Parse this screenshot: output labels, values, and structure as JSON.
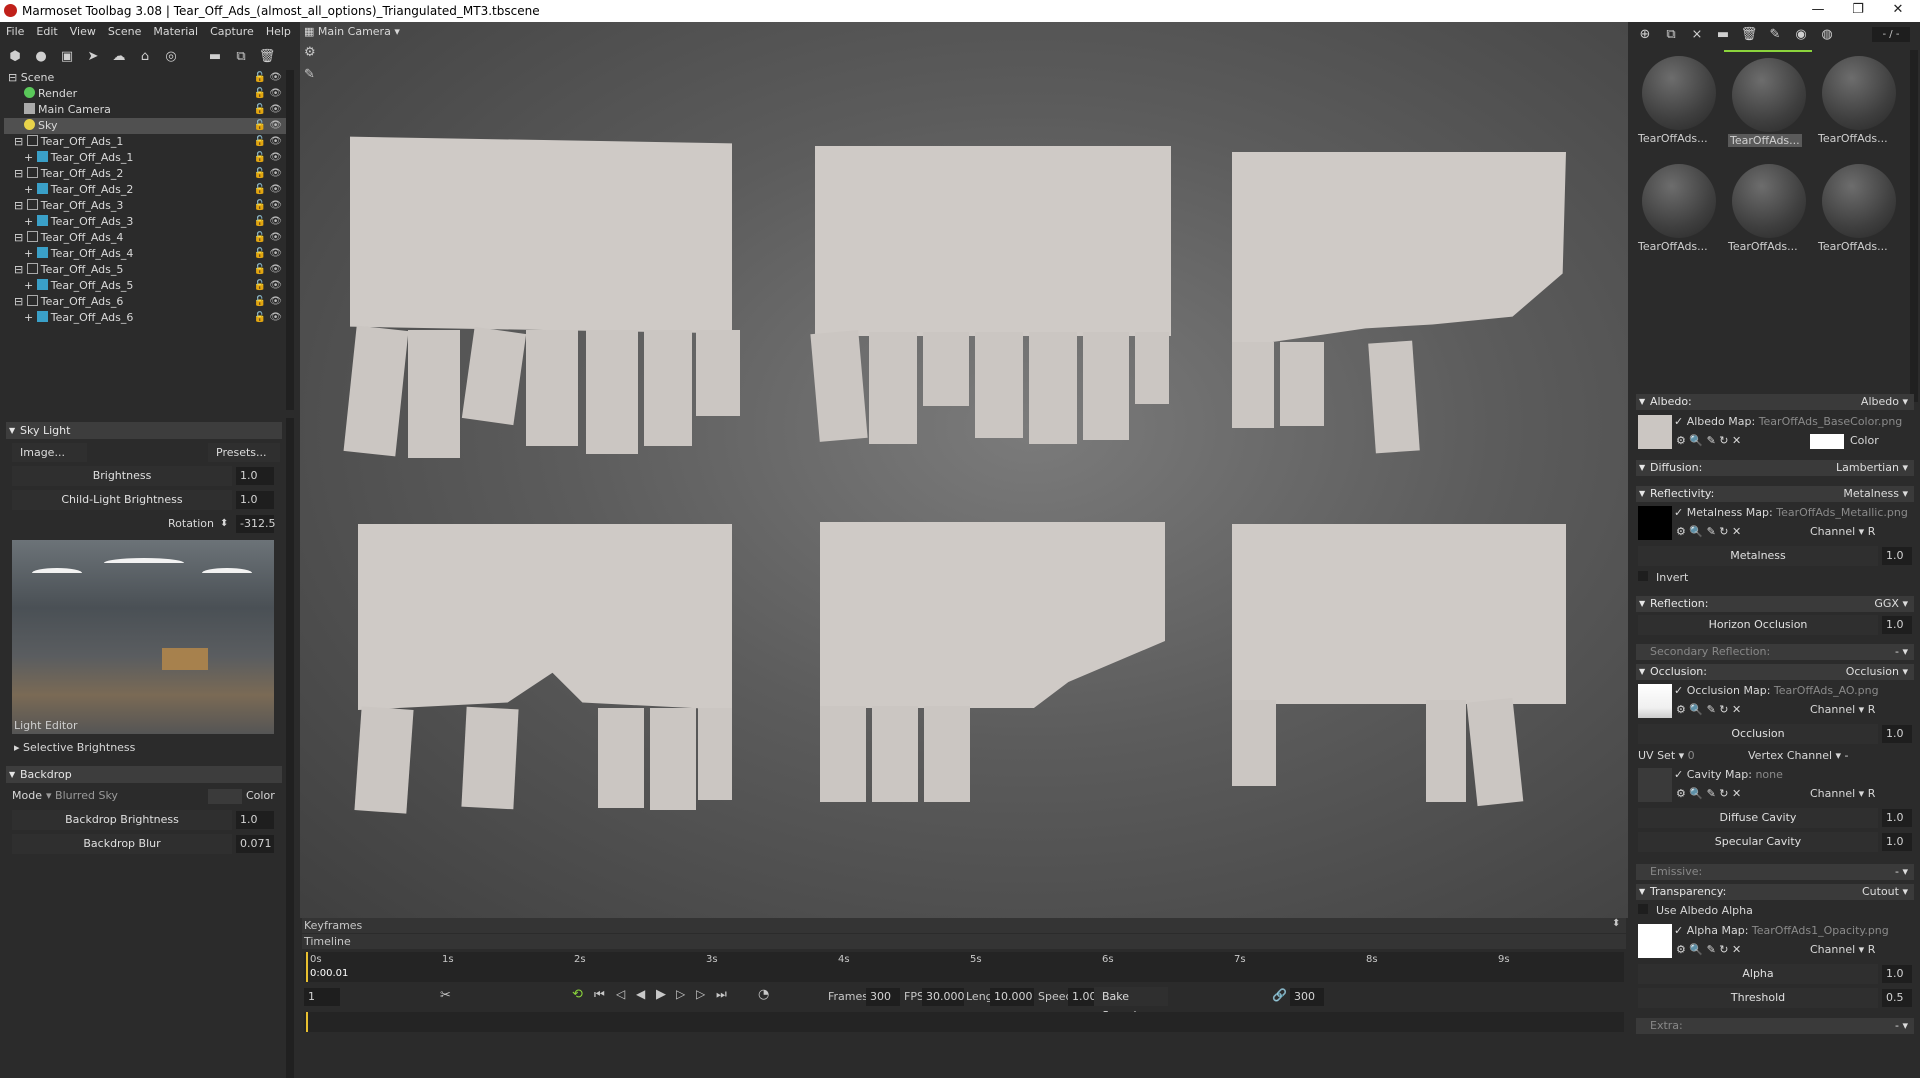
{
  "window": {
    "title": "Marmoset Toolbag 3.08  |  Tear_Off_Ads_(almost_all_options)_Triangulated_MT3.tbscene",
    "min": "—",
    "max": "❐",
    "close": "✕"
  },
  "menu": [
    "File",
    "Edit",
    "View",
    "Scene",
    "Material",
    "Capture",
    "Help"
  ],
  "viewport_header": {
    "camera": "Main Camera"
  },
  "scene_tree": [
    {
      "label": "Scene",
      "indent": 0
    },
    {
      "label": "Render",
      "indent": 1
    },
    {
      "label": "Main Camera",
      "indent": 1
    },
    {
      "label": "Sky",
      "indent": 1,
      "selected": true
    },
    {
      "label": "Tear_Off_Ads_1",
      "indent": 1
    },
    {
      "label": "Tear_Off_Ads_1",
      "indent": 2
    },
    {
      "label": "Tear_Off_Ads_2",
      "indent": 1
    },
    {
      "label": "Tear_Off_Ads_2",
      "indent": 2
    },
    {
      "label": "Tear_Off_Ads_3",
      "indent": 1
    },
    {
      "label": "Tear_Off_Ads_3",
      "indent": 2
    },
    {
      "label": "Tear_Off_Ads_4",
      "indent": 1
    },
    {
      "label": "Tear_Off_Ads_4",
      "indent": 2
    },
    {
      "label": "Tear_Off_Ads_5",
      "indent": 1
    },
    {
      "label": "Tear_Off_Ads_5",
      "indent": 2
    },
    {
      "label": "Tear_Off_Ads_6",
      "indent": 1
    },
    {
      "label": "Tear_Off_Ads_6",
      "indent": 2
    }
  ],
  "sky_light": {
    "header": "Sky Light",
    "image_btn": "Image...",
    "presets_btn": "Presets...",
    "brightness_label": "Brightness",
    "brightness": "1.0",
    "child_label": "Child-Light Brightness",
    "child": "1.0",
    "rotation_label": "Rotation",
    "rotation": "-312.5",
    "light_editor": "Light Editor",
    "selective": "Selective Brightness"
  },
  "backdrop": {
    "header": "Backdrop",
    "mode_label": "Mode",
    "mode_value": "Blurred Sky",
    "color_label": "Color",
    "brightness_label": "Backdrop Brightness",
    "brightness": "1.0",
    "blur_label": "Backdrop Blur",
    "blur": "0.071"
  },
  "timeline": {
    "keyframes": "Keyframes",
    "timeline": "Timeline",
    "ticks": [
      "0s",
      "1s",
      "2s",
      "3s",
      "4s",
      "5s",
      "6s",
      "7s",
      "8s",
      "9s"
    ],
    "current": "0:00.01",
    "frame_field": "1",
    "frames_label": "Frames",
    "frames": "300",
    "fps_label": "FPS",
    "fps": "30.000",
    "length_label": "Length",
    "length": "10.000",
    "speed_label": "Speed",
    "speed": "1.000",
    "bake_label": "Bake Speed",
    "end_frame": "300"
  },
  "materials": {
    "counter": "- / -",
    "thumbs": [
      "TearOffAds...",
      "TearOffAds...",
      "TearOffAds...",
      "TearOffAds...",
      "TearOffAds...",
      "TearOffAds..."
    ]
  },
  "props": {
    "albedo": {
      "section": "Albedo:",
      "mode": "Albedo",
      "map_label": "Albedo Map:",
      "map": "TearOffAds_BaseColor.png",
      "color_label": "Color"
    },
    "diffusion": {
      "section": "Diffusion:",
      "mode": "Lambertian"
    },
    "reflectivity": {
      "section": "Reflectivity:",
      "mode": "Metalness",
      "map_label": "Metalness Map:",
      "map": "TearOffAds_Metallic.png",
      "channel": "Channel",
      "channel_val": "R",
      "slider_label": "Metalness",
      "slider": "1.0",
      "invert": "Invert"
    },
    "reflection": {
      "section": "Reflection:",
      "mode": "GGX",
      "horizon_label": "Horizon Occlusion",
      "horizon": "1.0"
    },
    "secondary": {
      "section": "Secondary Reflection:",
      "mode": "-"
    },
    "occlusion": {
      "section": "Occlusion:",
      "mode": "Occlusion",
      "map_label": "Occlusion Map:",
      "map": "TearOffAds_AO.png",
      "channel": "Channel",
      "channel_val": "R",
      "slider_label": "Occlusion",
      "slider": "1.0",
      "uvset_label": "UV Set",
      "uvset": "0",
      "vertex_label": "Vertex Channel",
      "vertex": "-",
      "cavity_label": "Cavity Map:",
      "cavity": "none",
      "cavity_channel": "Channel",
      "cavity_channel_val": "R",
      "diffuse_label": "Diffuse Cavity",
      "diffuse": "1.0",
      "specular_label": "Specular Cavity",
      "specular": "1.0"
    },
    "emissive": {
      "section": "Emissive:",
      "mode": "-"
    },
    "transparency": {
      "section": "Transparency:",
      "mode": "Cutout",
      "use_alpha": "Use Albedo Alpha",
      "map_label": "Alpha Map:",
      "map": "TearOffAds1_Opacity.png",
      "channel": "Channel",
      "channel_val": "R",
      "alpha_label": "Alpha",
      "alpha": "1.0",
      "threshold_label": "Threshold",
      "threshold": "0.5"
    },
    "extra": {
      "section": "Extra:",
      "mode": "-"
    }
  }
}
